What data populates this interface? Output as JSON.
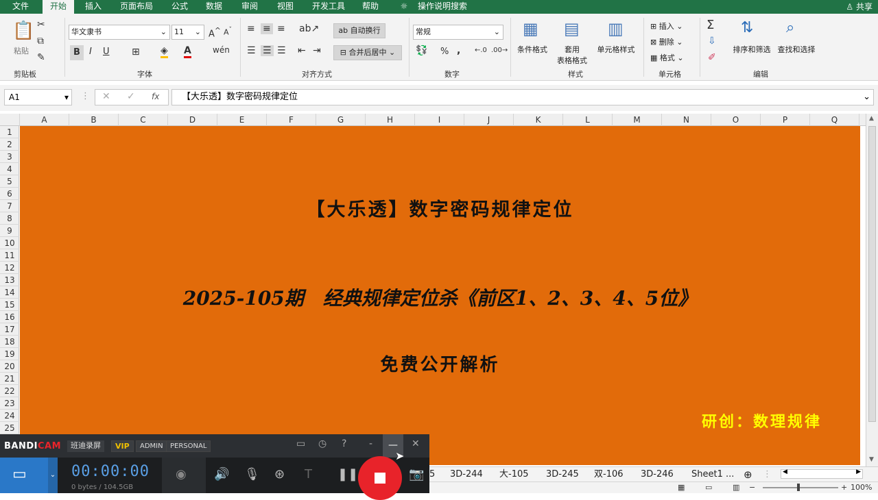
{
  "tabs": [
    "文件",
    "开始",
    "插入",
    "页面布局",
    "公式",
    "数据",
    "审阅",
    "视图",
    "开发工具",
    "帮助",
    "操作说明搜索"
  ],
  "share": "共享",
  "ribbon": {
    "paste": "粘贴",
    "clipboard": "剪贴板",
    "font_name": "华文隶书",
    "font_size": "11",
    "font_group": "字体",
    "wrap": "自动换行",
    "merge": "合并后居中",
    "align_group": "对齐方式",
    "number_format": "常规",
    "number_group": "数字",
    "cond_format": "条件格式",
    "table_format_1": "套用",
    "table_format_2": "表格格式",
    "cell_style": "单元格样式",
    "style_group": "样式",
    "insert": "插入",
    "delete": "删除",
    "format": "格式",
    "cells_group": "单元格",
    "sort": "排序和筛选",
    "find": "查找和选择",
    "edit_group": "编辑",
    "bold": "B",
    "italic": "I",
    "underline": "U",
    "percent": "%",
    "comma": ","
  },
  "formula_bar": {
    "name_box": "A1",
    "fx": "fx",
    "content": "【大乐透】数字密码规律定位"
  },
  "columns": [
    "A",
    "B",
    "C",
    "D",
    "E",
    "F",
    "G",
    "H",
    "I",
    "J",
    "K",
    "L",
    "M",
    "N",
    "O",
    "P",
    "Q"
  ],
  "rows": [
    "1",
    "2",
    "3",
    "4",
    "5",
    "6",
    "7",
    "8",
    "9",
    "10",
    "11",
    "12",
    "13",
    "14",
    "15",
    "16",
    "17",
    "18",
    "19",
    "20",
    "21",
    "22",
    "23",
    "24",
    "25"
  ],
  "sheet_content": {
    "title": "【大乐透】数字密码规律定位",
    "subtitle": "2025-105期　经典规律定位杀《前区1、2、3、4、5位》",
    "free": "免费公开解析",
    "author": "研创：数理规律"
  },
  "sheet_tabs": [
    "5",
    "3D-244",
    "大-105",
    "3D-245",
    "双-106",
    "3D-246",
    "Sheet1",
    "..."
  ],
  "status": {
    "zoom": "100%"
  },
  "bandicam": {
    "brand_a": "BANDI",
    "brand_b": "CAM",
    "brand_cn": "班迪录屏",
    "vip": "VIP",
    "admin": "ADMIN",
    "personal": "PERSONAL",
    "timer": "00:00:00",
    "bytes": "0 bytes / 104.5GB"
  },
  "colors": {
    "excel_green": "#217346",
    "sheet_fill": "#e26b0a",
    "author_text": "#ffff00"
  }
}
